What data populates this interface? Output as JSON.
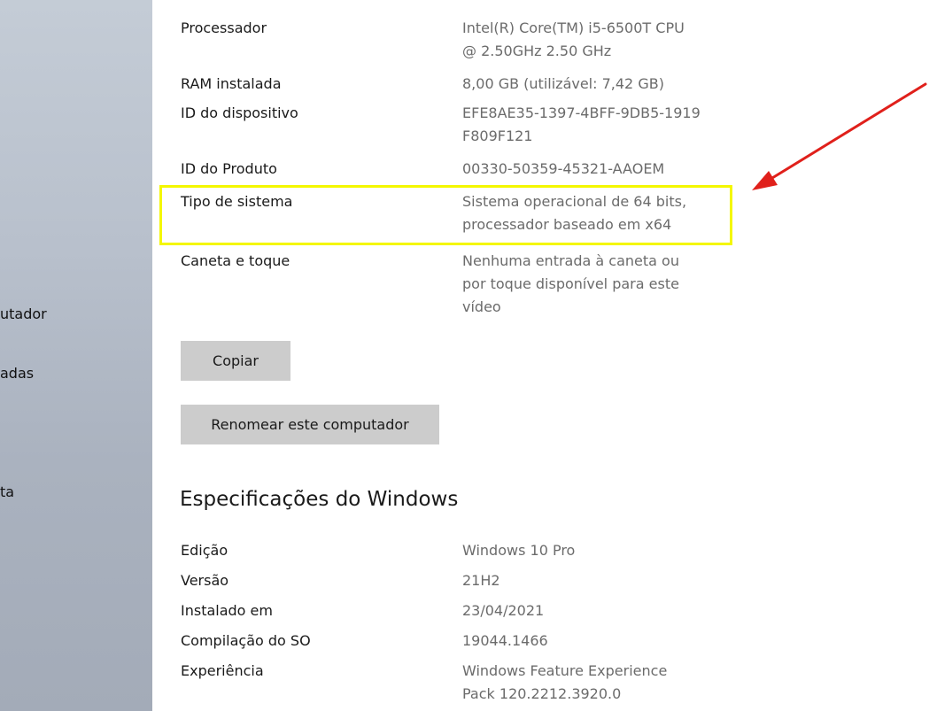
{
  "sidebar": {
    "items": [
      {
        "label": "utador"
      },
      {
        "label": "adas"
      },
      {
        "label": "ta"
      }
    ]
  },
  "device_specs": {
    "rows": [
      {
        "label": "Processador",
        "value": "Intel(R) Core(TM) i5-6500T CPU\n@ 2.50GHz   2.50 GHz"
      },
      {
        "label": "RAM instalada",
        "value": "8,00 GB (utilizável: 7,42 GB)"
      },
      {
        "label": "ID do dispositivo",
        "value": "EFE8AE35-1397-4BFF-9DB5-1919\nF809F121"
      },
      {
        "label": "ID do Produto",
        "value": "00330-50359-45321-AAOEM"
      },
      {
        "label": "Tipo de sistema",
        "value": "Sistema operacional de 64 bits,\nprocessador baseado em x64"
      },
      {
        "label": "Caneta e toque",
        "value": "Nenhuma entrada à caneta ou\npor toque disponível para este\nvídeo"
      }
    ],
    "copy_button": "Copiar",
    "rename_button": "Renomear este computador"
  },
  "windows_specs": {
    "title": "Especificações do Windows",
    "rows": [
      {
        "label": "Edição",
        "value": "Windows 10 Pro"
      },
      {
        "label": "Versão",
        "value": "21H2"
      },
      {
        "label": "Instalado em",
        "value": "23/04/2021"
      },
      {
        "label": "Compilação do SO",
        "value": "19044.1466"
      },
      {
        "label": "Experiência",
        "value": "Windows Feature Experience\nPack 120.2212.3920.0"
      }
    ]
  },
  "annotation": {
    "highlight_color": "#f4f700",
    "arrow_color": "#e0201b"
  }
}
